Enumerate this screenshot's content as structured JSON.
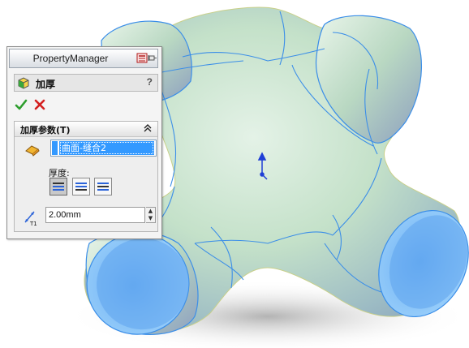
{
  "property_manager": {
    "title": "PropertyManager",
    "feature_title": "加厚",
    "help_symbol": "?",
    "params_group": {
      "title": "加厚参数(T)",
      "selected_face": "曲面-缝合2",
      "thickness_label": "厚度:",
      "thickness_value": "2.00mm",
      "thickness_icon_label": "T1"
    }
  },
  "icons": {
    "layout": "panel-layout-icon",
    "pin": "pushpin-icon",
    "feature": "thicken-feature-icon",
    "ok": "check-icon",
    "cancel": "x-icon",
    "collapse": "double-chevron-up-icon",
    "face": "face-selection-icon",
    "side1": "thicken-side1-icon",
    "side2": "thicken-side2-icon",
    "both": "thicken-both-sides-icon",
    "thickness": "thickness-dimension-icon"
  },
  "colors": {
    "selection_blue": "#3399ff",
    "ok_green": "#2e9e2e",
    "cancel_red": "#d42020",
    "model_green": "#c8e6cc",
    "model_blue": "#79b7f0",
    "edge_blue": "#3b8ee8"
  }
}
